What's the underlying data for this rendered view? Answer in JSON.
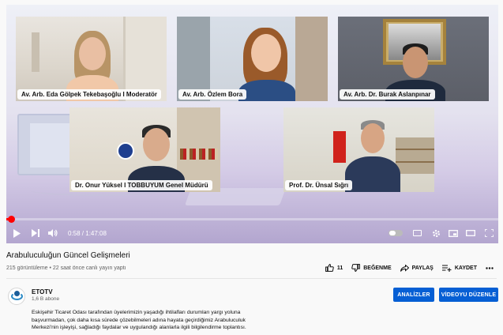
{
  "player": {
    "participants": [
      {
        "name": "Av. Arb. Eda Gölpek Tekebaşoğlu I Moderatör"
      },
      {
        "name": "Av. Arb. Özlem Bora"
      },
      {
        "name": "Av. Arb. Dr. Burak Aslanpınar"
      },
      {
        "name": "Dr. Onur Yüksel I TOBBUYUM Genel Müdürü"
      },
      {
        "name": "Prof. Dr. Ünsal Sığrı"
      }
    ],
    "time_current": "0:58",
    "time_total": "1:47:08",
    "time_display": "0:58 / 1:47:08",
    "progress_fraction": 0.009,
    "accent_color": "#ff0000"
  },
  "video": {
    "title": "Arabuluculuğun Güncel Gelişmeleri",
    "meta": "215 görüntüleme • 22 saat önce canlı yayın yaptı"
  },
  "actions": {
    "like_count": "11",
    "dislike_label": "BEĞENME",
    "share_label": "PAYLAŞ",
    "save_label": "KAYDET"
  },
  "channel": {
    "name": "ETOTV",
    "subscribers": "1,6 B abone",
    "analytics_label": "ANALİZLER",
    "edit_label": "VİDEOYU DÜZENLE",
    "button_color": "#065fd4"
  },
  "description": {
    "line1": "Eskişehir Ticaret Odası tarafından üyelerimizin yaşadığı ihtilafları durumları yargı yoluna",
    "line2": "başvurmadan, çok daha kısa sürede çözebilmeleri adına hayata geçirdiğimiz Arabuluculuk",
    "line3": "Merkezi'nin işleyişi, sağladığı faydalar ve uygulandığı alanlarla ilgili bilgilendirme toplantısı."
  }
}
